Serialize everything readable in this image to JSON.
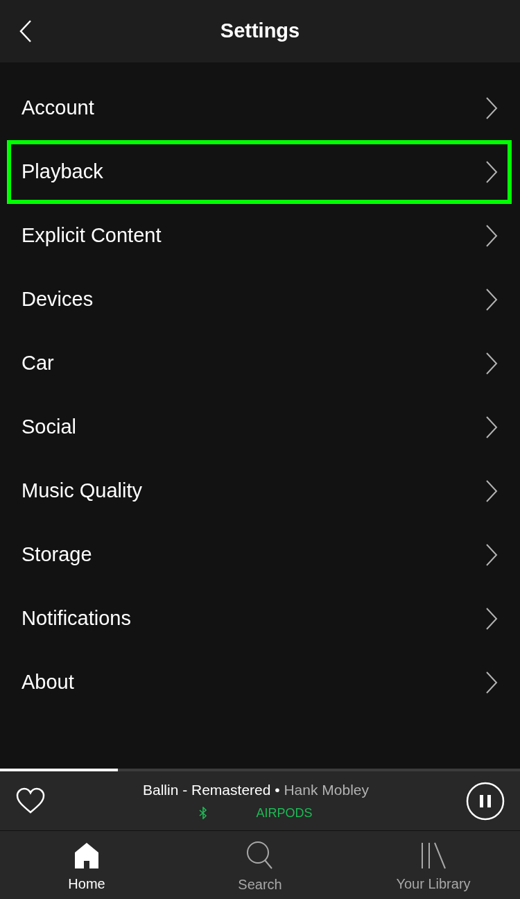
{
  "header": {
    "title": "Settings"
  },
  "settings_items": [
    {
      "label": "Account",
      "highlighted": false
    },
    {
      "label": "Playback",
      "highlighted": true
    },
    {
      "label": "Explicit Content",
      "highlighted": false
    },
    {
      "label": "Devices",
      "highlighted": false
    },
    {
      "label": "Car",
      "highlighted": false
    },
    {
      "label": "Social",
      "highlighted": false
    },
    {
      "label": "Music Quality",
      "highlighted": false
    },
    {
      "label": "Storage",
      "highlighted": false
    },
    {
      "label": "Notifications",
      "highlighted": false
    },
    {
      "label": "About",
      "highlighted": false
    }
  ],
  "now_playing": {
    "level": 0.227,
    "track": "Ballin - Remastered",
    "separator": "•",
    "artist": "Hank Mobley",
    "device": "AIRPODS",
    "liked": false,
    "playing": true
  },
  "tabs": [
    {
      "label": "Home",
      "kind": "home",
      "selected": true
    },
    {
      "label": "Search",
      "kind": "search",
      "selected": false
    },
    {
      "label": "Your Library",
      "kind": "library",
      "selected": false
    }
  ]
}
